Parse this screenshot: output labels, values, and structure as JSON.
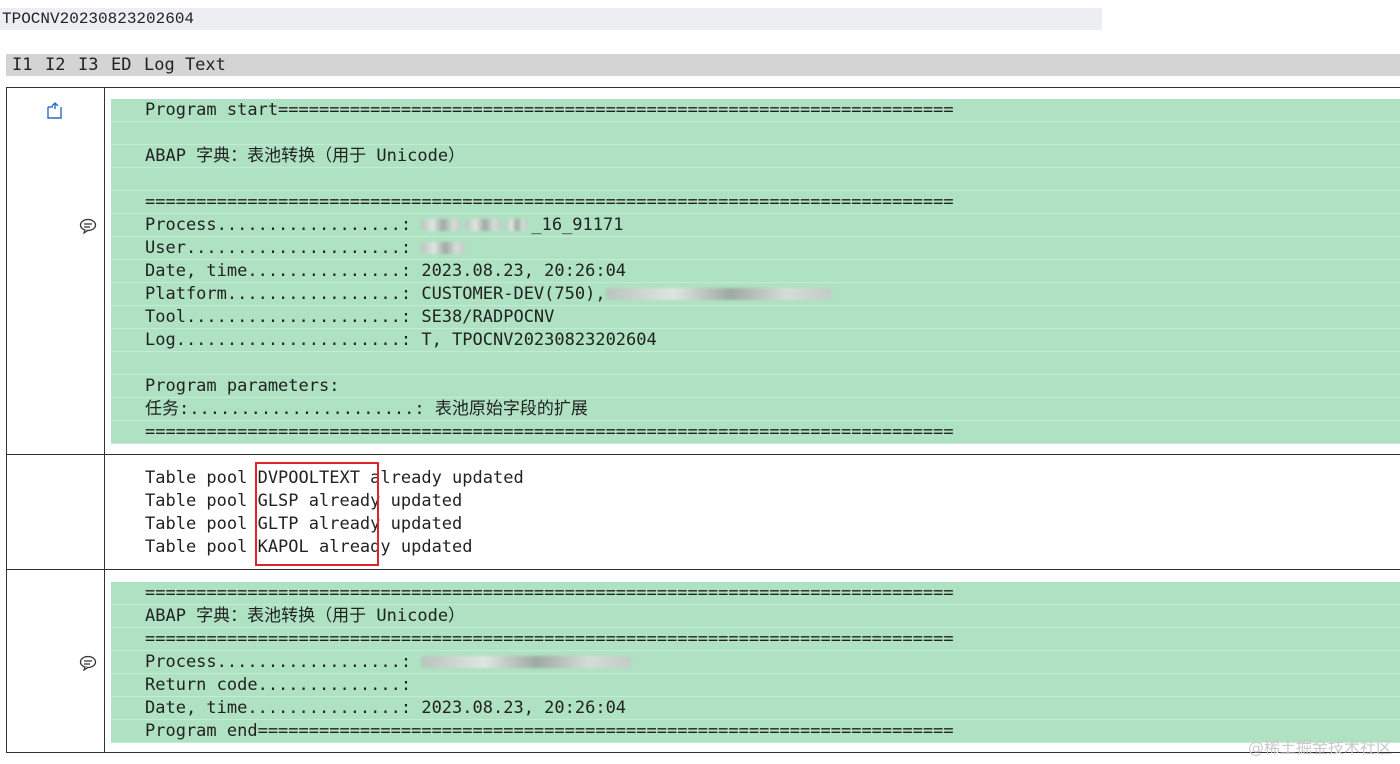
{
  "log_id": "TPOCNV20230823202604",
  "header": {
    "col_i1": "I1",
    "col_i2": "I2",
    "col_i3": "I3",
    "col_ed": "ED",
    "col_log_text": "Log Text"
  },
  "group1": {
    "icon_top": "document-open-icon",
    "icon_mid": "comment-icon",
    "lines": [
      "Program start==================================================================",
      "",
      "ABAP 字典：表池转换（用于 Unicode）",
      "",
      "===============================================================================",
      "Process..................: ",
      "User.....................: ",
      "Date, time...............: 2023.08.23, 20:26:04",
      "Platform.................: CUSTOMER-DEV(750),",
      "Tool.....................: SE38/RADPOCNV",
      "Log......................: T, TPOCNV20230823202604",
      "",
      "Program parameters:",
      "任务:......................: 表池原始字段的扩展",
      "==============================================================================="
    ],
    "process_suffix": "_16_91171"
  },
  "group2": {
    "lines": [
      "Table pool DVPOOLTEXT already updated",
      "Table pool GLSP already updated",
      "Table pool GLTP already updated",
      "Table pool KAPOL already updated"
    ]
  },
  "group3": {
    "icon_mid": "comment-icon",
    "lines": [
      "===============================================================================",
      "ABAP 字典：表池转换（用于 Unicode）",
      "===============================================================================",
      "Process..................: ",
      "Return code..............:",
      "Date, time...............: 2023.08.23, 20:26:04",
      "Program end===================================================================="
    ]
  },
  "watermark": "@稀土掘金技术社区",
  "colors": {
    "green_row": "#aee2c2",
    "header_bg": "#d4d4d4",
    "highlight": "#d9262c"
  }
}
